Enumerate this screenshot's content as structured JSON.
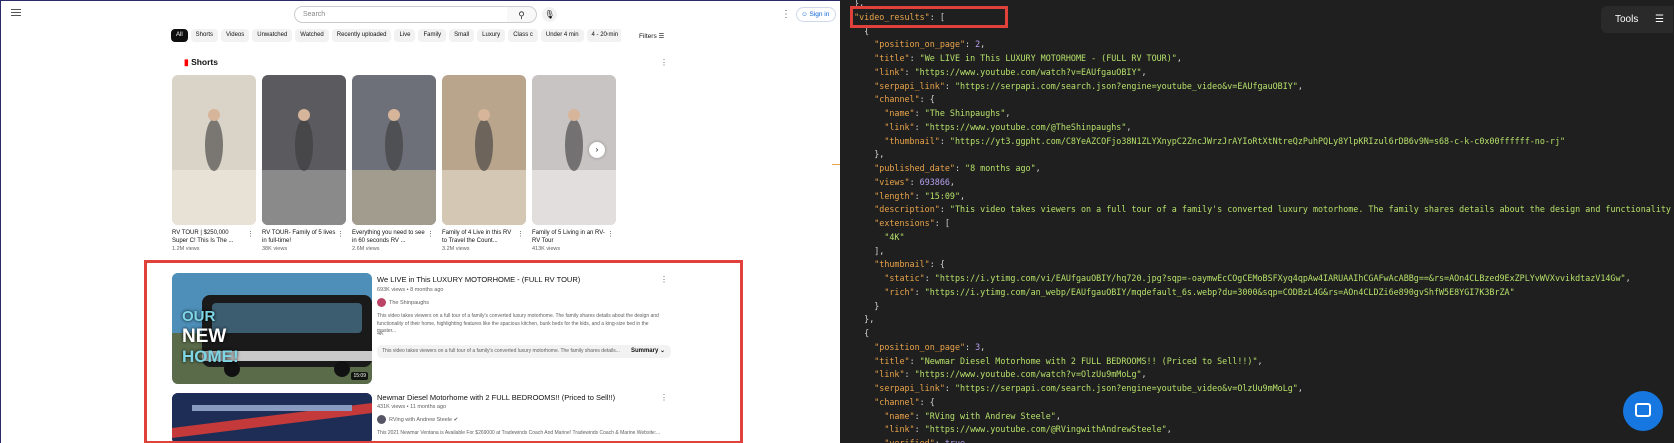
{
  "youtube": {
    "search_placeholder": "Search",
    "signin_label": "Sign in",
    "chips": [
      "All",
      "Shorts",
      "Videos",
      "Unwatched",
      "Watched",
      "Recently uploaded",
      "Live",
      "Family",
      "Small",
      "Luxury",
      "Class c",
      "Under 4 min",
      "4 - 20 min"
    ],
    "filters_label": "Filters",
    "shorts_title": "Shorts",
    "shorts": [
      {
        "title": "RV TOUR | $250,000 Super C! This Is The ...",
        "views": "1.2M views",
        "color": "#d9d3c8",
        "accent": "#e8e2d6"
      },
      {
        "title": "RV TOUR- Family of 5 lives in full-time!",
        "views": "38K views",
        "color": "#5a5a5f",
        "accent": "#8a8a8a"
      },
      {
        "title": "Everything you need to see in 60 seconds RV ...",
        "views": "2.6M views",
        "color": "#6e7079",
        "accent": "#a29c8f"
      },
      {
        "title": "Family of 4 Live in this RV to Travel the Count...",
        "views": "3.2M views",
        "color": "#b8a58c",
        "accent": "#d4c7b3"
      },
      {
        "title": "Family of 5 Living in an RV- RV Tour",
        "views": "413K views",
        "color": "#c9c4c4",
        "accent": "#e2dedd"
      }
    ],
    "videos": [
      {
        "title": "We LIVE in This LUXURY MOTORHOME - (FULL RV TOUR)",
        "meta": "693K views • 8 months ago",
        "channel": "The Shinpaughs",
        "description": "This video takes viewers on a full tour of a family's converted luxury motorhome. The family shares details about the design and functionality of their home, highlighting features like the spacious kitchen, bunk beds for the kids, and a king-size bed in the master...",
        "tag": "4K",
        "summary": "This video takes viewers on a full tour of a family's converted luxury motorhome. The family shares details...",
        "summary_label": "Summary",
        "thumb_text_1": "OUR",
        "thumb_text_2": "NEW",
        "thumb_text_3": "HOME!",
        "duration": "15:09"
      },
      {
        "title": "Newmar Diesel Motorhome with 2 FULL BEDROOMS!! (Priced to Sell!!)",
        "meta": "431K views • 11 months ago",
        "channel": "RVing with Andrew Steele",
        "description": "This 2021 Newmar Ventana is Available For $269000 at Tradewinds Coach And Marine! Tradewinds Coach & Marine Website:..."
      }
    ]
  },
  "viewer": {
    "tools_label": "Tools",
    "code_lines": [
      [
        [
          "p",
          "  },"
        ]
      ],
      [
        [
          "p",
          "  "
        ],
        [
          "k",
          "\"video_results\""
        ],
        [
          "p",
          ": ["
        ]
      ],
      [
        [
          "p",
          "    {"
        ]
      ],
      [
        [
          "p",
          "      "
        ],
        [
          "k",
          "\"position_on_page\""
        ],
        [
          "p",
          ": "
        ],
        [
          "n",
          "2"
        ],
        [
          "p",
          ","
        ]
      ],
      [
        [
          "p",
          "      "
        ],
        [
          "k",
          "\"title\""
        ],
        [
          "p",
          ": "
        ],
        [
          "s",
          "\"We LIVE in This LUXURY MOTORHOME - (FULL RV TOUR)\""
        ],
        [
          "p",
          ","
        ]
      ],
      [
        [
          "p",
          "      "
        ],
        [
          "k",
          "\"link\""
        ],
        [
          "p",
          ": "
        ],
        [
          "s",
          "\"https://www.youtube.com/watch?v=EAUfgauOBIY\""
        ],
        [
          "p",
          ","
        ]
      ],
      [
        [
          "p",
          "      "
        ],
        [
          "k",
          "\"serpapi_link\""
        ],
        [
          "p",
          ": "
        ],
        [
          "s",
          "\"https://serpapi.com/search.json?engine=youtube_video&v=EAUfgauOBIY\""
        ],
        [
          "p",
          ","
        ]
      ],
      [
        [
          "p",
          "      "
        ],
        [
          "k",
          "\"channel\""
        ],
        [
          "p",
          ": {"
        ]
      ],
      [
        [
          "p",
          "        "
        ],
        [
          "k",
          "\"name\""
        ],
        [
          "p",
          ": "
        ],
        [
          "s",
          "\"The Shinpaughs\""
        ],
        [
          "p",
          ","
        ]
      ],
      [
        [
          "p",
          "        "
        ],
        [
          "k",
          "\"link\""
        ],
        [
          "p",
          ": "
        ],
        [
          "s",
          "\"https://www.youtube.com/@TheShinpaughs\""
        ],
        [
          "p",
          ","
        ]
      ],
      [
        [
          "p",
          "        "
        ],
        [
          "k",
          "\"thumbnail\""
        ],
        [
          "p",
          ": "
        ],
        [
          "s",
          "\"https://yt3.ggpht.com/C8YeAZCOFjo38N1ZLYXnypC2ZncJWrzJrAYIoRtXtNtreQzPuhPQLy8YlpKRIzul6rDB6v9N=s68-c-k-c0x00ffffff-no-rj\""
        ]
      ],
      [
        [
          "p",
          "      },"
        ]
      ],
      [
        [
          "p",
          "      "
        ],
        [
          "k",
          "\"published_date\""
        ],
        [
          "p",
          ": "
        ],
        [
          "s",
          "\"8 months ago\""
        ],
        [
          "p",
          ","
        ]
      ],
      [
        [
          "p",
          "      "
        ],
        [
          "k",
          "\"views\""
        ],
        [
          "p",
          ": "
        ],
        [
          "n",
          "693866"
        ],
        [
          "p",
          ","
        ]
      ],
      [
        [
          "p",
          "      "
        ],
        [
          "k",
          "\"length\""
        ],
        [
          "p",
          ": "
        ],
        [
          "s",
          "\"15:09\""
        ],
        [
          "p",
          ","
        ]
      ],
      [
        [
          "p",
          "      "
        ],
        [
          "k",
          "\"description\""
        ],
        [
          "p",
          ": "
        ],
        [
          "s",
          "\"This video takes viewers on a full tour of a family's converted luxury motorhome. The family shares details about the design and functionality of their"
        ]
      ],
      [
        [
          "p",
          "      "
        ],
        [
          "k",
          "\"extensions\""
        ],
        [
          "p",
          ": ["
        ]
      ],
      [
        [
          "p",
          "        "
        ],
        [
          "s",
          "\"4K\""
        ]
      ],
      [
        [
          "p",
          "      ],"
        ]
      ],
      [
        [
          "p",
          "      "
        ],
        [
          "k",
          "\"thumbnail\""
        ],
        [
          "p",
          ": {"
        ]
      ],
      [
        [
          "p",
          "        "
        ],
        [
          "k",
          "\"static\""
        ],
        [
          "p",
          ": "
        ],
        [
          "s",
          "\"https://i.ytimg.com/vi/EAUfgauOBIY/hq720.jpg?sqp=-oaymwEcCOgCEMoBSFXyq4qpAw4IARUAAIhCGAFwAcABBg==&rs=AOn4CLBzed9ExZPLYvWVXvvikdtazV14Gw\""
        ],
        [
          "p",
          ","
        ]
      ],
      [
        [
          "p",
          "        "
        ],
        [
          "k",
          "\"rich\""
        ],
        [
          "p",
          ": "
        ],
        [
          "s",
          "\"https://i.ytimg.com/an_webp/EAUfgauOBIY/mqdefault_6s.webp?du=3000&sqp=CODBzL4G&rs=AOn4CLDZi6e890gvShfW5E8YGI7K3BrZA\""
        ]
      ],
      [
        [
          "p",
          "      }"
        ]
      ],
      [
        [
          "p",
          "    },"
        ]
      ],
      [
        [
          "p",
          "    {"
        ]
      ],
      [
        [
          "p",
          "      "
        ],
        [
          "k",
          "\"position_on_page\""
        ],
        [
          "p",
          ": "
        ],
        [
          "n",
          "3"
        ],
        [
          "p",
          ","
        ]
      ],
      [
        [
          "p",
          "      "
        ],
        [
          "k",
          "\"title\""
        ],
        [
          "p",
          ": "
        ],
        [
          "s",
          "\"Newmar Diesel Motorhome with 2 FULL BEDROOMS!! (Priced to Sell!!)\""
        ],
        [
          "p",
          ","
        ]
      ],
      [
        [
          "p",
          "      "
        ],
        [
          "k",
          "\"link\""
        ],
        [
          "p",
          ": "
        ],
        [
          "s",
          "\"https://www.youtube.com/watch?v=OlzUu9mMoLg\""
        ],
        [
          "p",
          ","
        ]
      ],
      [
        [
          "p",
          "      "
        ],
        [
          "k",
          "\"serpapi_link\""
        ],
        [
          "p",
          ": "
        ],
        [
          "s",
          "\"https://serpapi.com/search.json?engine=youtube_video&v=OlzUu9mMoLg\""
        ],
        [
          "p",
          ","
        ]
      ],
      [
        [
          "p",
          "      "
        ],
        [
          "k",
          "\"channel\""
        ],
        [
          "p",
          ": {"
        ]
      ],
      [
        [
          "p",
          "        "
        ],
        [
          "k",
          "\"name\""
        ],
        [
          "p",
          ": "
        ],
        [
          "s",
          "\"RVing with Andrew Steele\""
        ],
        [
          "p",
          ","
        ]
      ],
      [
        [
          "p",
          "        "
        ],
        [
          "k",
          "\"link\""
        ],
        [
          "p",
          ": "
        ],
        [
          "s",
          "\"https://www.youtube.com/@RVingwithAndrewSteele\""
        ],
        [
          "p",
          ","
        ]
      ],
      [
        [
          "p",
          "        "
        ],
        [
          "k",
          "\"verified\""
        ],
        [
          "p",
          ": "
        ],
        [
          "n",
          "true"
        ],
        [
          "p",
          ","
        ]
      ]
    ]
  }
}
